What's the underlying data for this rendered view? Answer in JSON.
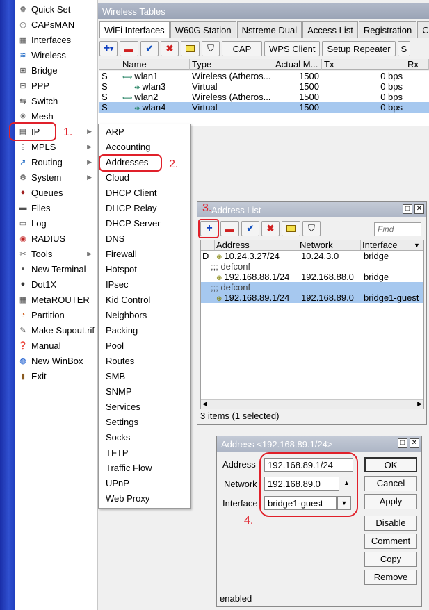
{
  "main_menu": [
    {
      "label": "Quick Set",
      "icon": "quick-set-icon",
      "has_sub": false
    },
    {
      "label": "CAPsMAN",
      "icon": "capsman-icon",
      "has_sub": false
    },
    {
      "label": "Interfaces",
      "icon": "interfaces-icon",
      "has_sub": false
    },
    {
      "label": "Wireless",
      "icon": "wireless-icon",
      "has_sub": false
    },
    {
      "label": "Bridge",
      "icon": "bridge-icon",
      "has_sub": false
    },
    {
      "label": "PPP",
      "icon": "ppp-icon",
      "has_sub": false
    },
    {
      "label": "Switch",
      "icon": "switch-icon",
      "has_sub": false
    },
    {
      "label": "Mesh",
      "icon": "mesh-icon",
      "has_sub": false
    },
    {
      "label": "IP",
      "icon": "ip-icon",
      "has_sub": true
    },
    {
      "label": "MPLS",
      "icon": "mpls-icon",
      "has_sub": true
    },
    {
      "label": "Routing",
      "icon": "routing-icon",
      "has_sub": true
    },
    {
      "label": "System",
      "icon": "system-icon",
      "has_sub": true
    },
    {
      "label": "Queues",
      "icon": "queues-icon",
      "has_sub": false
    },
    {
      "label": "Files",
      "icon": "files-icon",
      "has_sub": false
    },
    {
      "label": "Log",
      "icon": "log-icon",
      "has_sub": false
    },
    {
      "label": "RADIUS",
      "icon": "radius-icon",
      "has_sub": false
    },
    {
      "label": "Tools",
      "icon": "tools-icon",
      "has_sub": true
    },
    {
      "label": "New Terminal",
      "icon": "terminal-icon",
      "has_sub": false
    },
    {
      "label": "Dot1X",
      "icon": "dot1x-icon",
      "has_sub": false
    },
    {
      "label": "MetaROUTER",
      "icon": "metarouter-icon",
      "has_sub": false
    },
    {
      "label": "Partition",
      "icon": "partition-icon",
      "has_sub": false
    },
    {
      "label": "Make Supout.rif",
      "icon": "supout-icon",
      "has_sub": false
    },
    {
      "label": "Manual",
      "icon": "manual-icon",
      "has_sub": false
    },
    {
      "label": "New WinBox",
      "icon": "winbox-icon",
      "has_sub": false
    },
    {
      "label": "Exit",
      "icon": "exit-icon",
      "has_sub": false
    }
  ],
  "ip_submenu": [
    "ARP",
    "Accounting",
    "Addresses",
    "Cloud",
    "DHCP Client",
    "DHCP Relay",
    "DHCP Server",
    "DNS",
    "Firewall",
    "Hotspot",
    "IPsec",
    "Kid Control",
    "Neighbors",
    "Packing",
    "Pool",
    "Routes",
    "SMB",
    "SNMP",
    "Services",
    "Settings",
    "Socks",
    "TFTP",
    "Traffic Flow",
    "UPnP",
    "Web Proxy"
  ],
  "wireless_tables": {
    "title": "Wireless Tables",
    "tabs": [
      "WiFi Interfaces",
      "W60G Station",
      "Nstreme Dual",
      "Access List",
      "Registration",
      "Co"
    ],
    "buttons": {
      "cap": "CAP",
      "wps": "WPS Client",
      "repeater": "Setup Repeater",
      "more": "S"
    },
    "columns": [
      "",
      "Name",
      "Type",
      "Actual M...",
      "Tx",
      "Rx"
    ],
    "rows": [
      {
        "flag": "S",
        "name": "wlan1",
        "type": "Wireless (Atheros...",
        "mtu": "1500",
        "tx": "0 bps",
        "indent": false,
        "selected": false
      },
      {
        "flag": "S",
        "name": "wlan3",
        "type": "Virtual",
        "mtu": "1500",
        "tx": "0 bps",
        "indent": true,
        "selected": false
      },
      {
        "flag": "S",
        "name": "wlan2",
        "type": "Wireless (Atheros...",
        "mtu": "1500",
        "tx": "0 bps",
        "indent": false,
        "selected": false
      },
      {
        "flag": "S",
        "name": "wlan4",
        "type": "Virtual",
        "mtu": "1500",
        "tx": "0 bps",
        "indent": true,
        "selected": true
      }
    ]
  },
  "address_list": {
    "title": "Address List",
    "find_placeholder": "Find",
    "columns": [
      "Address",
      "Network",
      "Interface"
    ],
    "rows": [
      {
        "kind": "entry",
        "flag": "D",
        "address": "10.24.3.27/24",
        "network": "10.24.3.0",
        "interface": "bridge",
        "selected": false
      },
      {
        "kind": "comment",
        "text": ";;; defconf",
        "selected": false
      },
      {
        "kind": "entry",
        "flag": "",
        "address": "192.168.88.1/24",
        "network": "192.168.88.0",
        "interface": "bridge",
        "selected": false
      },
      {
        "kind": "comment",
        "text": ";;; defconf",
        "selected": true
      },
      {
        "kind": "entry",
        "flag": "",
        "address": "192.168.89.1/24",
        "network": "192.168.89.0",
        "interface": "bridge1-guest",
        "selected": true
      }
    ],
    "status": "3 items (1 selected)"
  },
  "address_dialog": {
    "title": "Address <192.168.89.1/24>",
    "labels": {
      "address": "Address",
      "network": "Network",
      "interface": "Interface"
    },
    "values": {
      "address": "192.168.89.1/24",
      "network": "192.168.89.0",
      "interface": "bridge1-guest"
    },
    "buttons": [
      "OK",
      "Cancel",
      "Apply",
      "Disable",
      "Comment",
      "Copy",
      "Remove"
    ],
    "status": "enabled"
  },
  "annotations": [
    "1.",
    "2.",
    "3.",
    "4."
  ],
  "colors": {
    "highlight": "#e0202a",
    "selection": "#a6c8ef",
    "sidebar": "#2040c0"
  }
}
